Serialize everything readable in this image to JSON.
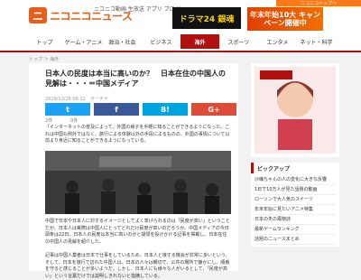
{
  "header": {
    "logo_mark": "ニ",
    "logo_text": "ニコニコニュース",
    "site_menu": "ニコニコ動画  生放送  アプリ  ブログ",
    "nico_link": "ニコニコトップへ",
    "ad_left": "ドラマ24 銀魂",
    "ad_right": "年末年始10大 キャンペーン開催中"
  },
  "nav": {
    "items": [
      {
        "label": "トップ"
      },
      {
        "label": "ゲーム・アニメ"
      },
      {
        "label": "政治・社会"
      },
      {
        "label": "ビジネス"
      },
      {
        "label": "海外"
      },
      {
        "label": "スポーツ"
      },
      {
        "label": "エンタメ"
      },
      {
        "label": "ネット・科学"
      }
    ],
    "active_index": 4
  },
  "breadcrumb": "トップ ＞ 海外",
  "article": {
    "title": "日本人の民度は本当に高いのか？　日本在住の中国人の見解は・・・＝中国メディア",
    "meta": "2019/12/26 06:12　サーチナ",
    "share": {
      "twitter": "t",
      "facebook": "f",
      "hatena": "B!",
      "google": "G+"
    },
    "counts": [
      "2件",
      "0件"
    ],
    "paragraphs": [
      "「インターネットの普及によって、外国の様子を手軽に知ることができるようになった。これは中国も例外ではなく、旅行による体験以外の手段によるものの、外国の事情について以前より身近に知ることができるようになっている。",
      "中国で日本や日本人に対するイメージとしてよく挙げられるのは「民度が高い」ということだが、日本人は実際は中国人にとってどれだけ民度が高いのだろうか。中国メディアの今日頭条は22日、日本人の民度は本当に高いのかと疑問を投げかける記事を掲載し、日本在住の中国人の見解を紹介した。",
      "記事は中国人業者は日本で仕事をしているため、日本人と接する機会が非常に多いという。そして、日本を旅行で訪れた中国人は、日本の人々は親切で、公共の場所で静かにし、順番を守ると感じることが多いようだ。しかし、日本人にも様々な人がいるとして、「民度が高い」という言葉だけでは説明しきれないと指摘している。"
    ]
  },
  "sidebar": {
    "pickup_title": "ピックアップ",
    "pickup_items": [
      "沙織ちゃんの人の変化に大きな反響",
      "1日で10万人が見た話題の動画",
      "ローソンで大人気のスイーツ",
      "年末年始に見たいアニメ特集",
      "日本の冬の風物詩",
      "最新ゲームランキング",
      "話題のニュースまとめ"
    ]
  },
  "colors": {
    "accent": "#b01010",
    "brand": "#e85d1a",
    "twitter": "#1da1f2",
    "facebook": "#3b5998",
    "hatena": "#00a4de",
    "google": "#dd4b39"
  }
}
